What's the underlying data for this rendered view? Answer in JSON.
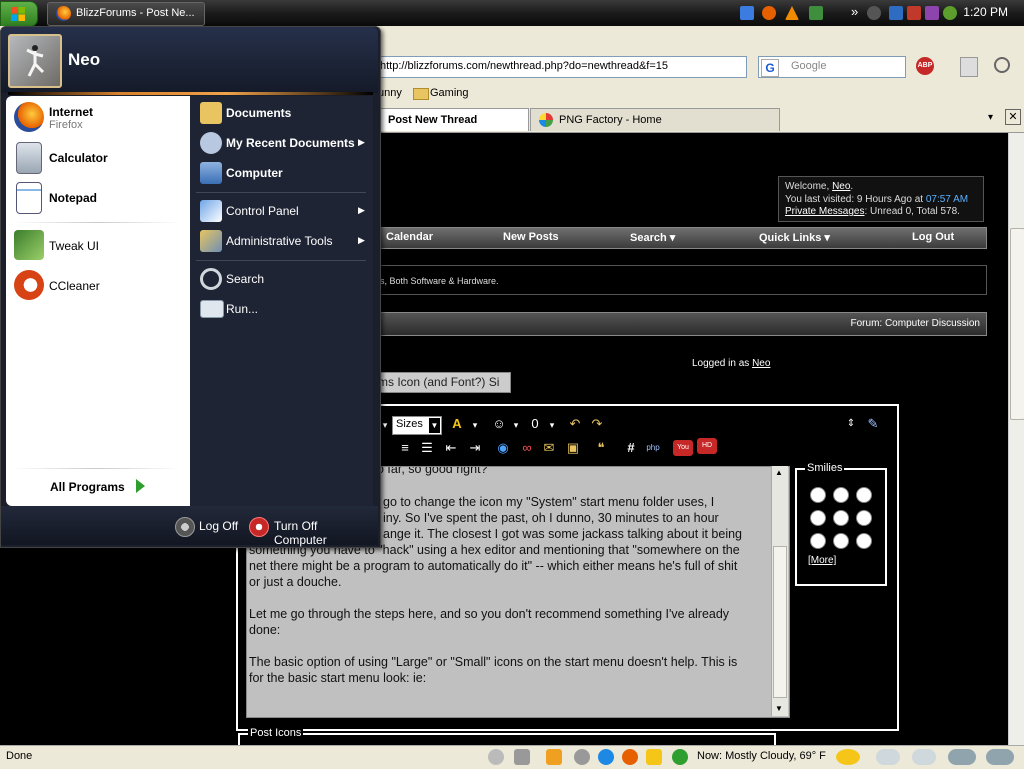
{
  "taskbar": {
    "start_label": "start",
    "task_button": "BlizzForums - Post Ne...",
    "tray_expand": "»",
    "clock": "1:20 PM"
  },
  "start_menu": {
    "user": "Neo",
    "pinned": [
      {
        "label": "Internet",
        "sub": "Firefox",
        "icon": "firefox-icon"
      },
      {
        "label": "Calculator",
        "icon": "calculator-icon"
      },
      {
        "label": "Notepad",
        "icon": "notepad-icon"
      }
    ],
    "recent": [
      {
        "label": "Tweak UI",
        "icon": "tweakui-icon"
      },
      {
        "label": "CCleaner",
        "icon": "ccleaner-icon"
      }
    ],
    "all_programs": "All Programs",
    "right": [
      {
        "label": "Documents",
        "bold": true,
        "arrow": false
      },
      {
        "label": "My Recent Documents",
        "bold": true,
        "arrow": true
      },
      {
        "label": "Computer",
        "bold": true,
        "arrow": false
      },
      {
        "label": "Control Panel",
        "bold": false,
        "arrow": true
      },
      {
        "label": "Administrative Tools",
        "bold": false,
        "arrow": true
      },
      {
        "label": "Search",
        "bold": false,
        "arrow": false
      },
      {
        "label": "Run...",
        "bold": false,
        "arrow": false
      }
    ],
    "log_off": "Log Off",
    "turn_off": "Turn Off Computer"
  },
  "browser": {
    "url": "http://blizzforums.com/newthread.php?do=newthread&f=15",
    "search_placeholder": "Google",
    "bookmarks": [
      "unny",
      "Gaming"
    ],
    "tabs": [
      "Post New Thread",
      "PNG Factory - Home"
    ],
    "status": "Done",
    "weather": "Now: Mostly Cloudy, 69° F"
  },
  "page": {
    "welcome": {
      "line1_prefix": "Welcome, ",
      "user": "Neo",
      "line2_prefix": "You last visited: 9 Hours Ago at ",
      "time": "07:57 AM",
      "pm_link": "Private Messages",
      "pm_rest": ": Unread 0, Total 578."
    },
    "nav": [
      "Calendar",
      "New Posts",
      "Search ▾",
      "Quick Links ▾",
      "Log Out"
    ],
    "tagline": "s, Both Software & Hardware.",
    "forum": "Forum: Computer Discussion",
    "logged_in_prefix": "Logged in as ",
    "logged_in_user": "Neo",
    "subject": "ms Icon (and Font?) Si",
    "sizes": "Sizes",
    "smilies_title": "Smilies",
    "more": "[More]",
    "post_icons": "Post Icons",
    "message": [
      "o far, so good right?",
      "go to change the icon my \"System\" start menu folder uses, I",
      "iny. So I've spent the past, oh I dunno, 30 minutes to an hour",
      "ange it. The closest I got was some jackass talking about it being",
      "something you have to \"hack\" using a hex editor and mentioning that \"somewhere on the",
      "net there might be a program to automatically do it\" -- which either means he's full of shit",
      "or just a douche.",
      "",
      "Let me go through the steps here, and so you don't recommend something I've already",
      "done:",
      "",
      "The basic option of using \"Large\" or \"Small\" icons on the start menu doesn't help. This is",
      "for the basic start menu look: ie:"
    ]
  }
}
